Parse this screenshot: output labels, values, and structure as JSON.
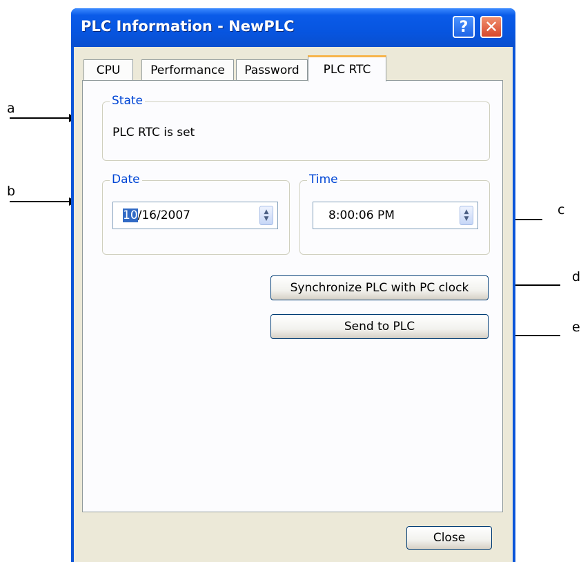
{
  "window": {
    "title": "PLC Information - NewPLC",
    "help_icon": "?",
    "close_icon": "✕"
  },
  "tabs": [
    {
      "label": "CPU",
      "active": false
    },
    {
      "label": "Performance",
      "active": false
    },
    {
      "label": "Password",
      "active": false
    },
    {
      "label": "PLC RTC",
      "active": true
    }
  ],
  "state": {
    "group_label": "State",
    "text": "PLC RTC is set"
  },
  "date": {
    "group_label": "Date",
    "selected_part": "10",
    "rest": "/16/2007"
  },
  "time": {
    "group_label": "Time",
    "value": "8:00:06 PM"
  },
  "buttons": {
    "sync": "Synchronize PLC with PC clock",
    "send": "Send to PLC",
    "close": "Close"
  },
  "annotations": {
    "a": "a",
    "b": "b",
    "c": "c",
    "d": "d",
    "e": "e"
  },
  "colors": {
    "titlebar": "#0a5be8",
    "dialog_bg": "#ece9d8",
    "group_label": "#0046d5",
    "active_tab_accent": "#f7b44a",
    "selection": "#316ac5"
  }
}
